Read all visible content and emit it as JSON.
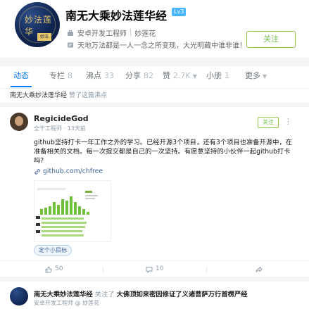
{
  "profile": {
    "name": "南无大乘妙法莲华经",
    "level": "Lv3",
    "job": "安卓开发工程师",
    "sep": "|",
    "company": "妙莲花",
    "bio": "天地万法都是一人一念之所变现，大光明藏中谁非谁！",
    "follow_label": "关注",
    "avatar_text": "妙法莲华",
    "avatar_stamp": "妙法"
  },
  "tabs": [
    {
      "label": "动态",
      "count": ""
    },
    {
      "label": "专栏",
      "count": "8"
    },
    {
      "label": "沸点",
      "count": "33"
    },
    {
      "label": "分享",
      "count": "82"
    },
    {
      "label": "赞",
      "count": "2.7K"
    },
    {
      "label": "小册",
      "count": "1"
    },
    {
      "label": "更多",
      "count": ""
    }
  ],
  "subline": {
    "who": "南无大乘妙法莲华经",
    "action": "赞了这篇沸点"
  },
  "post": {
    "author": "RegicideGod",
    "role": "全干工程师",
    "dot": "·",
    "time": "13天前",
    "follow_label": "关注",
    "menu": "⋮",
    "content": "github坚持打卡一年工作之外的学习。已经开源3个项目，还有3个项目也准备开源中，在准备相关的文档。每一次提交都是自己的一次坚持。有愿意坚持的小伙伴一起github打卡吗?",
    "link": "github.com/chfree",
    "tag": "定个小目标",
    "likes": "50",
    "comments": "10",
    "share_icon": "share-icon"
  },
  "post2": {
    "author": "南无大乘妙法莲华经",
    "action": "关注了",
    "topic": "大佛顶如来密因修证了义诸菩萨万行首楞严经",
    "job": "安卓开发工程师",
    "dot": "@",
    "company": "妙莲花"
  },
  "colors": {
    "accent": "#007fff",
    "follow": "#6cbd45",
    "link": "#406599",
    "meta": "#8a9aa9"
  }
}
